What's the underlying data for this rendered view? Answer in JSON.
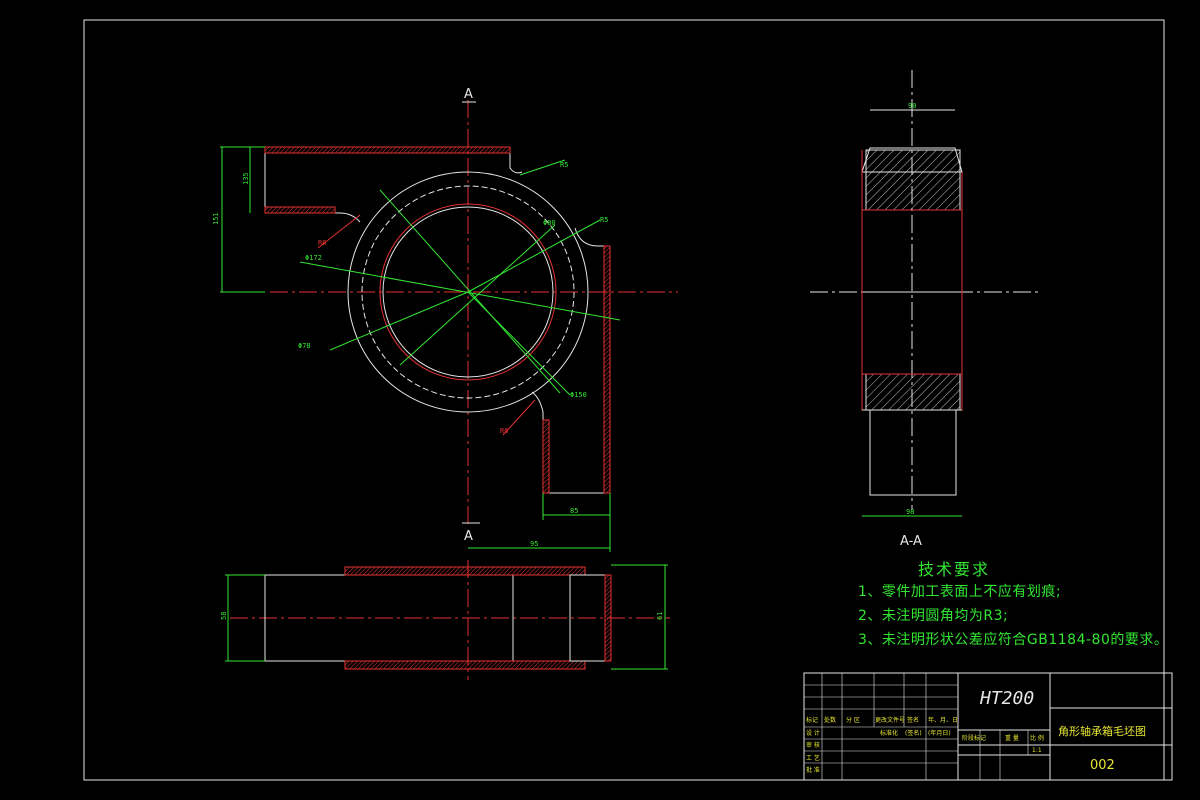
{
  "notes": {
    "title": "技术要求",
    "lines": [
      "1、零件加工表面上不应有划痕;",
      "2、未注明圆角均为R3;",
      "3、未注明形状公差应符合GB1184-80的要求。"
    ]
  },
  "labels": {
    "section_top": "A",
    "section_bottom": "A",
    "section_view": "A-A"
  },
  "dimensions": {
    "d1": "R6",
    "d2": "R5",
    "d3": "Φ80",
    "d4": "Φ172",
    "d5": "Φ78",
    "d6": "Φ150",
    "d7": "R6",
    "d8": "R5",
    "d9": "85",
    "d10": "95",
    "d11": "151",
    "d12": "135",
    "d13": "90",
    "d14": "98",
    "d15": "61",
    "d16": "58"
  },
  "title_block": {
    "material": "HT200",
    "drawing_name": "角形轴承箱毛坯图",
    "drawing_number": "002",
    "header_labels": [
      "标记",
      "处数",
      "分 区",
      "更改文件号",
      "签名",
      "年、月、日"
    ],
    "design_label": "设 计",
    "std_label": "标准化",
    "approve_label": "(签名)",
    "date_label": "(年月日)",
    "review_label": "审 核",
    "process_label": "工 艺",
    "approve2_label": "批 准",
    "stage_labels": [
      "阶段标记",
      "重 量",
      "比 例"
    ],
    "scale": "1:1"
  },
  "colors": {
    "white": "#e6e6e6",
    "red": "#e63232",
    "green": "#32e632",
    "yellow": "#e6e632"
  }
}
